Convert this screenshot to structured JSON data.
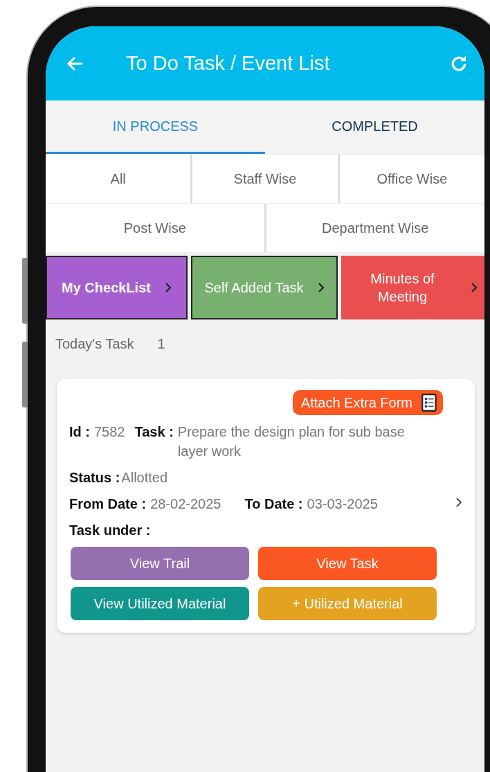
{
  "header": {
    "title": "To Do Task / Event List"
  },
  "tabs": [
    {
      "label": "IN PROCESS",
      "selected": true
    },
    {
      "label": "COMPLETED",
      "selected": false
    }
  ],
  "filters": [
    [
      "All",
      "Staff Wise",
      "Office Wise"
    ],
    [
      "Post Wise",
      "Department Wise"
    ]
  ],
  "shortcuts": [
    {
      "label": "My CheckList",
      "color": "#a55fd0",
      "bold": true
    },
    {
      "label": "Self Added Task",
      "color": "#77b06f",
      "bold": false
    },
    {
      "label": "Minutes of Meeting",
      "color": "#e94f4f",
      "bold": false
    }
  ],
  "section": {
    "label": "Today's Task",
    "count": "1"
  },
  "card": {
    "attach_button": "Attach Extra Form",
    "id_label": "Id :",
    "id_value": "7582",
    "task_label": "Task :",
    "task_value": "Prepare the design plan for sub base layer work",
    "status_label": "Status :",
    "status_value": "Allotted",
    "from_label": "From Date :",
    "from_value": "28-02-2025",
    "to_label": "To Date :",
    "to_value": "03-03-2025",
    "task_under_label": "Task under :",
    "buttons": [
      {
        "label": "View Trail",
        "color": "#9470b0"
      },
      {
        "label": "View Task",
        "color": "#fa5722"
      },
      {
        "label": "View Utilized Material",
        "color": "#10968a"
      },
      {
        "label": "+ Utilized Material",
        "color": "#e3a21f"
      }
    ]
  }
}
